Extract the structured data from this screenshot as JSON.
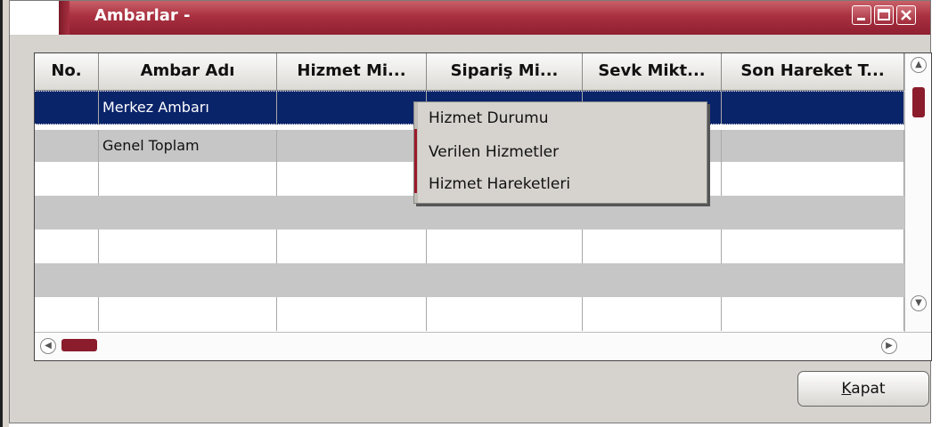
{
  "window": {
    "title": "Ambarlar -",
    "controls": [
      "minimize-icon",
      "maximize-icon",
      "close-icon"
    ]
  },
  "grid": {
    "columns": [
      "No.",
      "Ambar Adı",
      "Hizmet Mi...",
      "Sipariş  Mi...",
      "Sevk Mikt...",
      "Son Hareket T..."
    ],
    "rows": [
      {
        "no": "",
        "name": "Merkez Ambarı",
        "selected": true
      },
      {
        "no": "",
        "name": "Genel Toplam",
        "selected": false
      }
    ]
  },
  "context_menu": {
    "items": [
      "Hizmet Durumu",
      "Verilen Hizmetler",
      "Hizmet Hareketleri"
    ]
  },
  "footer": {
    "close_label_underlined": "K",
    "close_label_rest": "apat"
  },
  "colors": {
    "title_bar": "#a93040",
    "selection": "#0a246a",
    "scroll_thumb": "#8a1c2c"
  }
}
